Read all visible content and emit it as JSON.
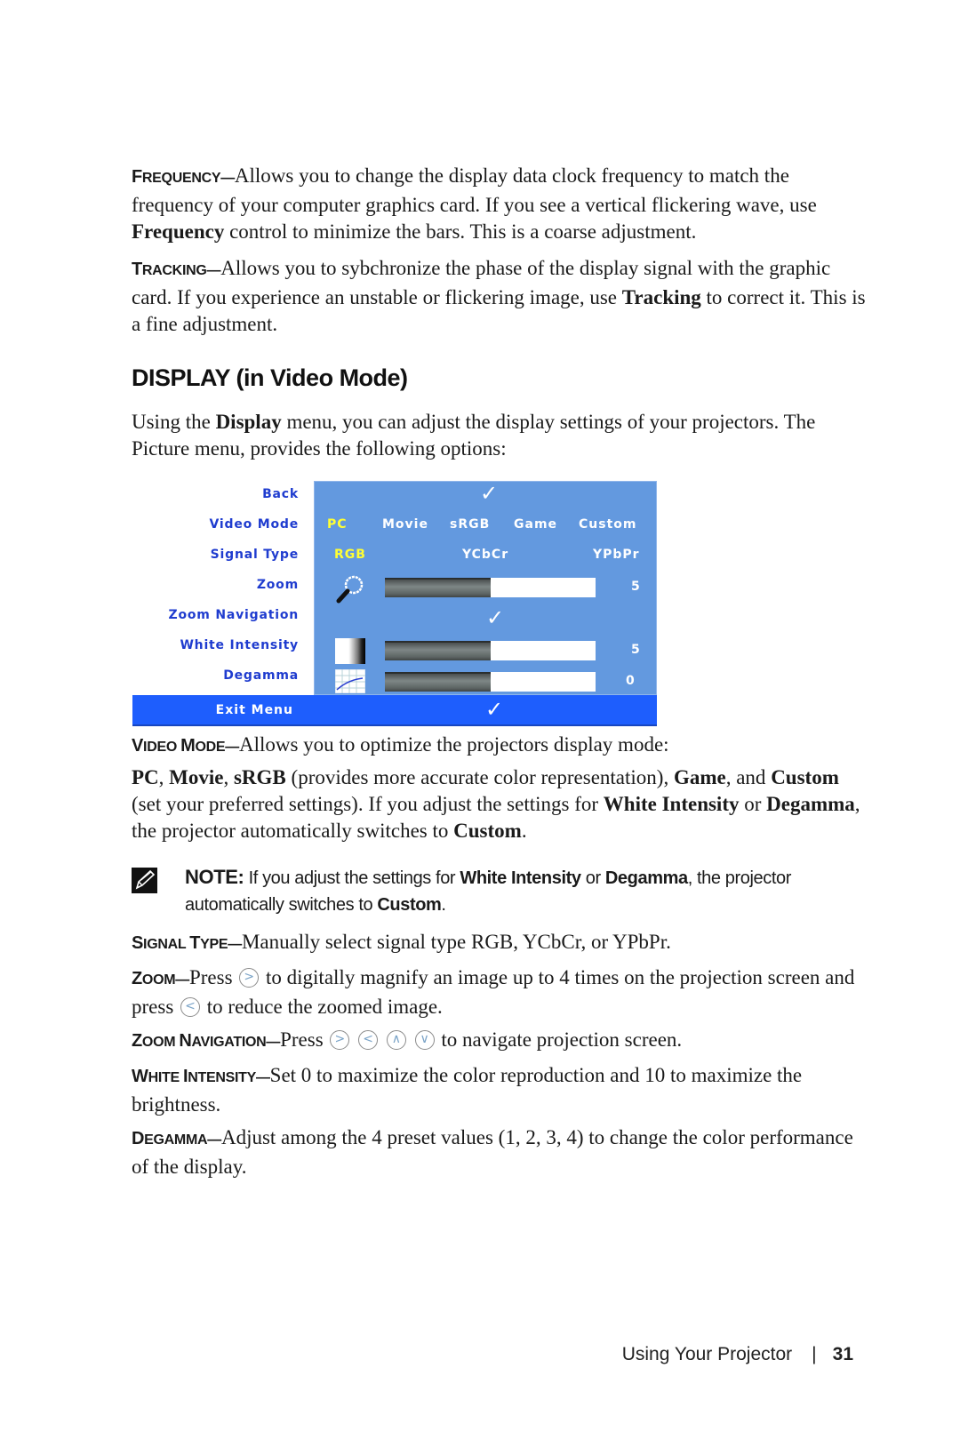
{
  "paragraphs": {
    "frequency": {
      "lead": "Frequency",
      "dash": "—",
      "text_1": "Allows you to change the display data clock frequency to match the frequency of your computer graphics card. If you see a vertical flickering wave, use ",
      "bold": "Frequency",
      "text_2": " control to minimize the bars. This is a coarse adjustment."
    },
    "tracking": {
      "lead": "Tracking",
      "dash": "—",
      "text_1": "Allows you to sybchronize the phase of the display signal with the graphic card. If you experience an unstable or flickering image, use ",
      "bold": "Tracking",
      "text_2": " to correct it. This is a fine adjustment."
    }
  },
  "section": {
    "title": "DISPLAY (in Video Mode)",
    "intro_1": "Using the ",
    "intro_bold": "Display",
    "intro_2": " menu, you can adjust the display settings of your projectors. The Picture menu, provides the following options:"
  },
  "osd_menu": {
    "labels": [
      "Back",
      "Video Mode",
      "Signal Type",
      "Zoom",
      "Zoom Navigation",
      "White Intensity",
      "Degamma"
    ],
    "exit_label": "Exit Menu",
    "check_glyph": "✓",
    "video_modes": [
      "PC",
      "Movie",
      "sRGB",
      "Game",
      "Custom"
    ],
    "video_mode_selected": "PC",
    "signal_types": [
      "RGB",
      "YCbCr",
      "YPbPr"
    ],
    "signal_type_selected": "RGB",
    "zoom": {
      "value": "5",
      "fill_fraction": 0.5
    },
    "white_intensity": {
      "value": "5",
      "fill_fraction": 0.5
    },
    "degamma": {
      "value": "0",
      "fill_fraction": 0.5
    },
    "colors": {
      "panel": "#6399df",
      "exit_bar": "#1e5efd",
      "label": "#1f3ccf",
      "selected": "#ffff33"
    }
  },
  "video_mode_desc": {
    "lead": "Video Mode",
    "dash": "—",
    "text": "Allows you to optimize the projectors display mode:",
    "detail": [
      {
        "b": "PC"
      },
      {
        "t": ", "
      },
      {
        "b": "Movie"
      },
      {
        "t": ", "
      },
      {
        "b": "sRGB"
      },
      {
        "t": " (provides more accurate color representation), "
      },
      {
        "b": "Game"
      },
      {
        "t": ", and "
      },
      {
        "b": "Custom"
      },
      {
        "t": " (set your preferred settings). If you adjust the settings for "
      },
      {
        "b": "White Intensity"
      },
      {
        "t": " or "
      },
      {
        "b": "Degamma"
      },
      {
        "t": ", the projector automatically switches to "
      },
      {
        "b": "Custom"
      },
      {
        "t": "."
      }
    ]
  },
  "note": {
    "label": "NOTE:",
    "text_1": " If you adjust the settings for ",
    "bold_1": "White Intensity",
    "text_2": " or ",
    "bold_2": "Degamma",
    "text_3": ", the projector automatically switches to ",
    "bold_3": "Custom",
    "text_4": "."
  },
  "signal_type_desc": {
    "lead": "Signal Type",
    "dash": "—",
    "text": "Manually select signal type RGB, YCbCr, or YPbPr."
  },
  "zoom_desc": {
    "lead": "Zoom",
    "dash": "—",
    "text_1": "Press ",
    "btn_right": ">",
    "text_2": " to digitally magnify an image up to 4 times on the projection screen and press ",
    "btn_left": "<",
    "text_3": " to reduce the zoomed image."
  },
  "zoom_nav_desc": {
    "lead": "Zoom Navigation",
    "dash": "—",
    "text_1": "Press ",
    "buttons": [
      ">",
      "<",
      "∧",
      "∨"
    ],
    "text_2": " to navigate projection screen."
  },
  "white_intensity_desc": {
    "lead": "White Intensity",
    "dash": "—",
    "text": "Set 0 to maximize the color reproduction and 10 to maximize the brightness."
  },
  "degamma_desc": {
    "lead": "Degamma",
    "dash": "—",
    "text": "Adjust among the 4 preset values (1, 2, 3, 4) to change the color performance of the display."
  },
  "footer": {
    "chapter": "Using Your Projector",
    "separator": "|",
    "page": "31"
  }
}
